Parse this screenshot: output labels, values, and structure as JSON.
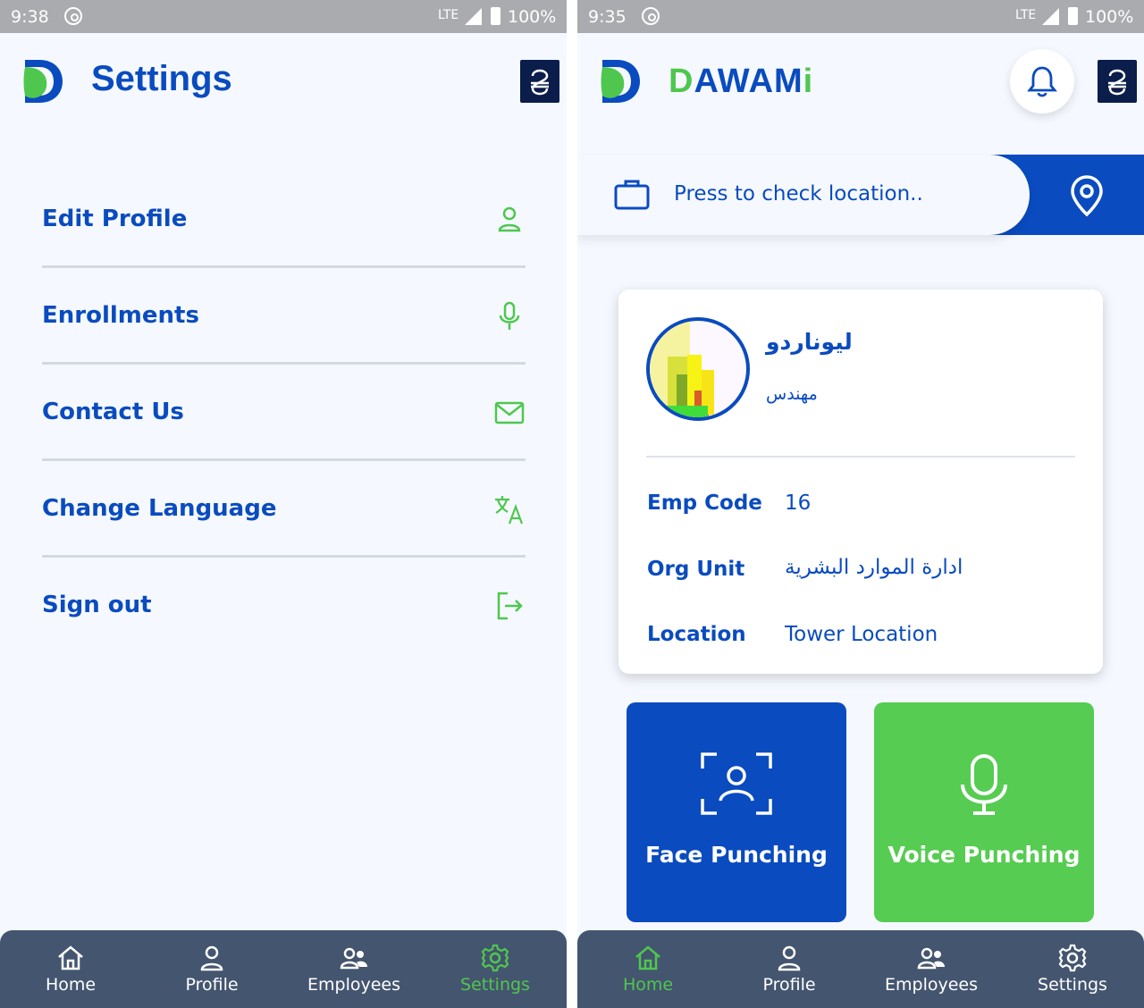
{
  "left_screen": {
    "status": {
      "time": "9:38",
      "network": "LTE",
      "battery": "100%"
    },
    "title": "Settings",
    "menu": [
      {
        "label": "Edit Profile",
        "icon": "user-icon"
      },
      {
        "label": "Enrollments",
        "icon": "microphone-icon"
      },
      {
        "label": "Contact Us",
        "icon": "envelope-icon"
      },
      {
        "label": "Change Language",
        "icon": "translate-icon"
      },
      {
        "label": "Sign out",
        "icon": "sign-out-icon"
      }
    ],
    "nav": [
      {
        "label": "Home",
        "icon": "home-icon",
        "active": false
      },
      {
        "label": "Profile",
        "icon": "user-icon",
        "active": false
      },
      {
        "label": "Employees",
        "icon": "users-icon",
        "active": false
      },
      {
        "label": "Settings",
        "icon": "gear-icon",
        "active": true
      }
    ]
  },
  "right_screen": {
    "status": {
      "time": "9:35",
      "network": "LTE",
      "battery": "100%"
    },
    "brand": {
      "first": "D",
      "middle": "AWAM",
      "last": "i"
    },
    "location_prompt": "Press to check location..",
    "employee": {
      "name": "ليوناردو",
      "job_title": "مهندس",
      "fields": [
        {
          "label": "Emp Code",
          "value": "16"
        },
        {
          "label": "Org Unit",
          "value": "ادارة الموارد البشرية"
        },
        {
          "label": "Location",
          "value": "Tower Location"
        }
      ]
    },
    "actions": {
      "face": "Face Punching",
      "voice": "Voice Punching"
    },
    "nav": [
      {
        "label": "Home",
        "icon": "home-icon",
        "active": true
      },
      {
        "label": "Profile",
        "icon": "user-icon",
        "active": false
      },
      {
        "label": "Employees",
        "icon": "users-icon",
        "active": false
      },
      {
        "label": "Settings",
        "icon": "gear-icon",
        "active": false
      }
    ]
  },
  "colors": {
    "primary": "#0a4bbf",
    "accent": "#4fc74e",
    "navbar": "#44556f",
    "background": "#f5f9ff"
  }
}
